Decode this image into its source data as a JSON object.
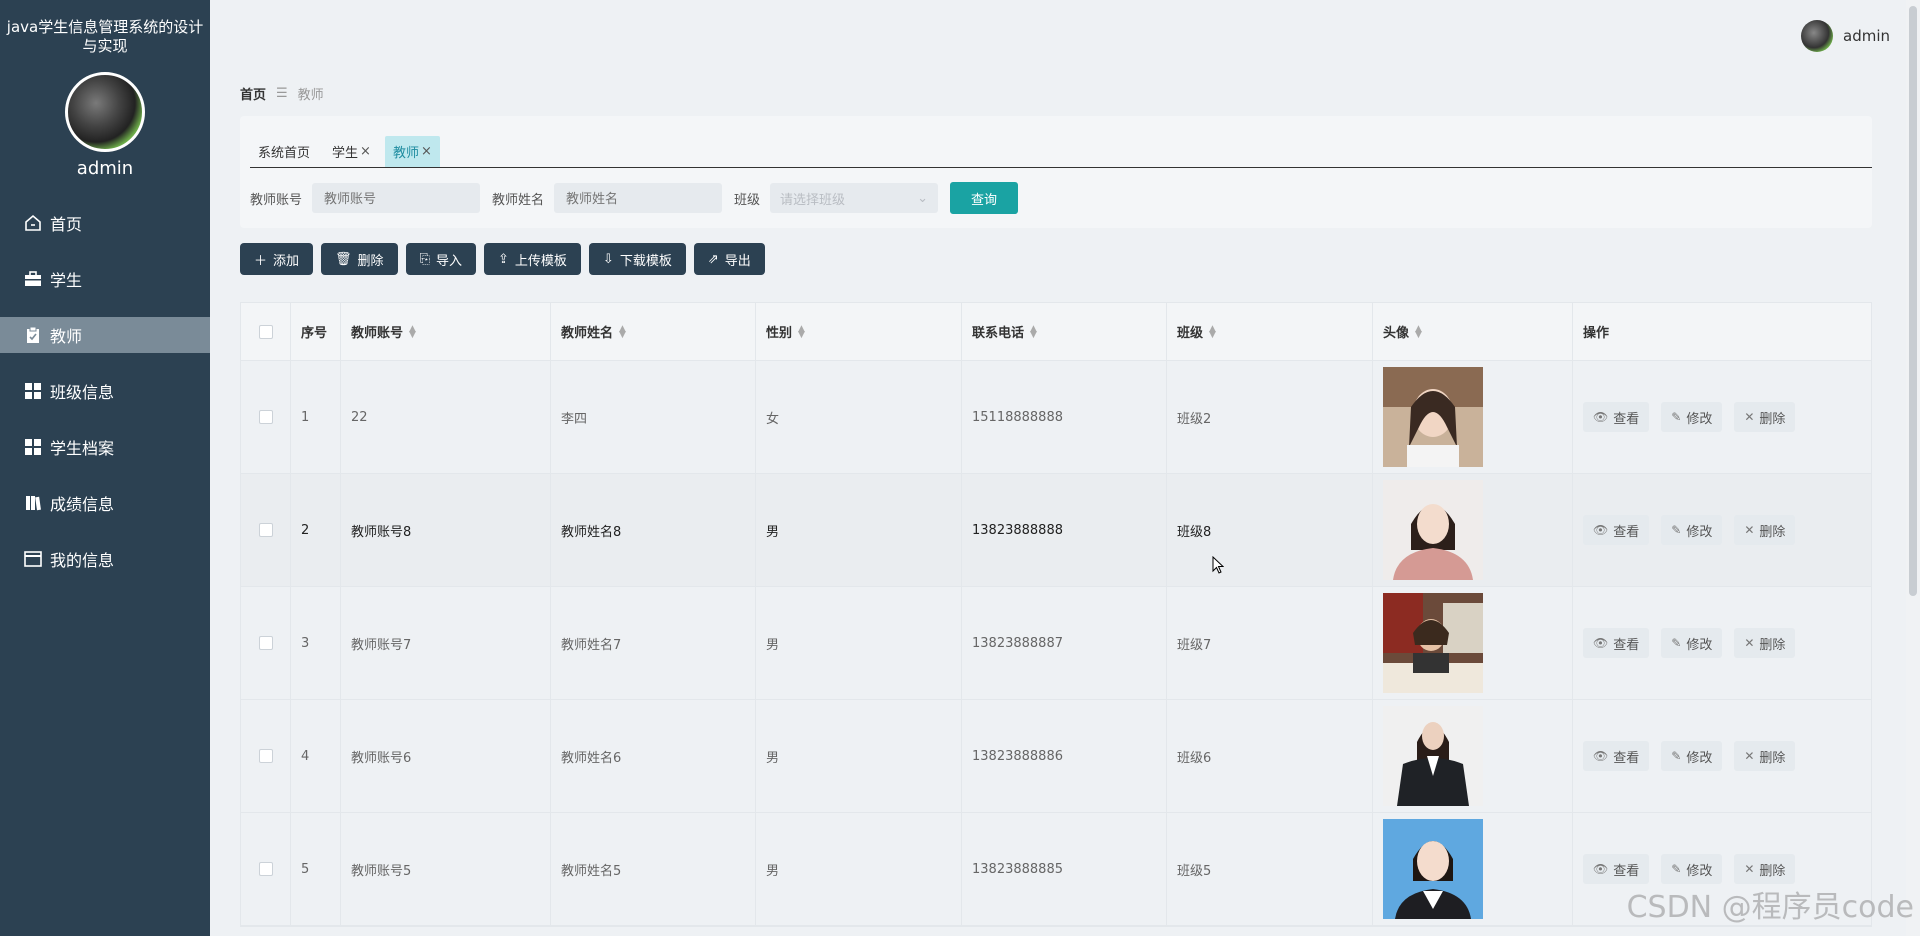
{
  "app": {
    "title": "java学生信息管理系统的设计与实现"
  },
  "sidebar": {
    "username": "admin",
    "items": [
      {
        "label": "首页",
        "icon": "home-icon"
      },
      {
        "label": "学生",
        "icon": "briefcase-icon"
      },
      {
        "label": "教师",
        "icon": "clipboard-icon",
        "active": true
      },
      {
        "label": "班级信息",
        "icon": "grid-icon"
      },
      {
        "label": "学生档案",
        "icon": "grid-icon"
      },
      {
        "label": "成绩信息",
        "icon": "book-icon"
      },
      {
        "label": "我的信息",
        "icon": "card-icon"
      }
    ]
  },
  "header": {
    "username": "admin"
  },
  "breadcrumb": {
    "home": "首页",
    "separator": "☰",
    "current": "教师"
  },
  "tabs": [
    {
      "label": "系统首页",
      "closable": false
    },
    {
      "label": "学生",
      "closable": true
    },
    {
      "label": "教师",
      "closable": true,
      "active": true
    }
  ],
  "search": {
    "account_label": "教师账号",
    "account_placeholder": "教师账号",
    "name_label": "教师姓名",
    "name_placeholder": "教师姓名",
    "class_label": "班级",
    "class_placeholder": "请选择班级",
    "query_button": "查询"
  },
  "toolbar": {
    "add": "添加",
    "delete": "删除",
    "import": "导入",
    "upload_template": "上传模板",
    "download_template": "下载模板",
    "export": "导出"
  },
  "table": {
    "columns": [
      "序号",
      "教师账号",
      "教师姓名",
      "性别",
      "联系电话",
      "班级",
      "头像",
      "操作"
    ],
    "rows": [
      {
        "index": "1",
        "account": "22",
        "name": "李四",
        "gender": "女",
        "phone": "15118888888",
        "class": "班级2"
      },
      {
        "index": "2",
        "account": "教师账号8",
        "name": "教师姓名8",
        "gender": "男",
        "phone": "13823888888",
        "class": "班级8"
      },
      {
        "index": "3",
        "account": "教师账号7",
        "name": "教师姓名7",
        "gender": "男",
        "phone": "13823888887",
        "class": "班级7"
      },
      {
        "index": "4",
        "account": "教师账号6",
        "name": "教师姓名6",
        "gender": "男",
        "phone": "13823888886",
        "class": "班级6"
      },
      {
        "index": "5",
        "account": "教师账号5",
        "name": "教师姓名5",
        "gender": "男",
        "phone": "13823888885",
        "class": "班级5"
      }
    ],
    "actions": {
      "view": "查看",
      "edit": "修改",
      "delete": "删除"
    }
  },
  "watermark": "CSDN @程序员code"
}
